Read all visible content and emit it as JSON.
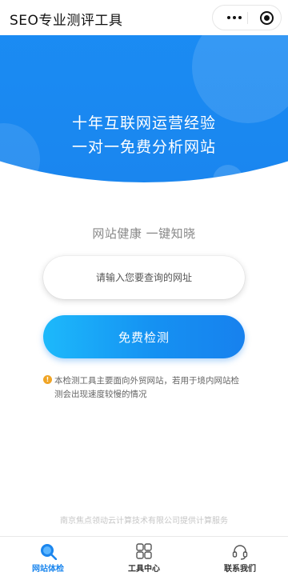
{
  "nav": {
    "title": "SEO专业测评工具"
  },
  "hero": {
    "line1": "十年互联网运营经验",
    "line2": "一对一免费分析网站"
  },
  "subtitle": "网站健康 一键知晓",
  "search": {
    "placeholder": "请输入您要查询的网址",
    "value": ""
  },
  "check_button": "免费检测",
  "notice": "本检测工具主要面向外贸网站，若用于境内网站检测会出现速度较慢的情况",
  "footer_note": "南京焦点领动云计算技术有限公司提供计算服务",
  "tabs": [
    {
      "label": "网站体检",
      "icon": "search-icon",
      "active": true
    },
    {
      "label": "工具中心",
      "icon": "grid-icon",
      "active": false
    },
    {
      "label": "联系我们",
      "icon": "headset-icon",
      "active": false
    }
  ],
  "colors": {
    "primary": "#1b86ee",
    "accent": "#1db9fb",
    "warning": "#f0a526"
  }
}
